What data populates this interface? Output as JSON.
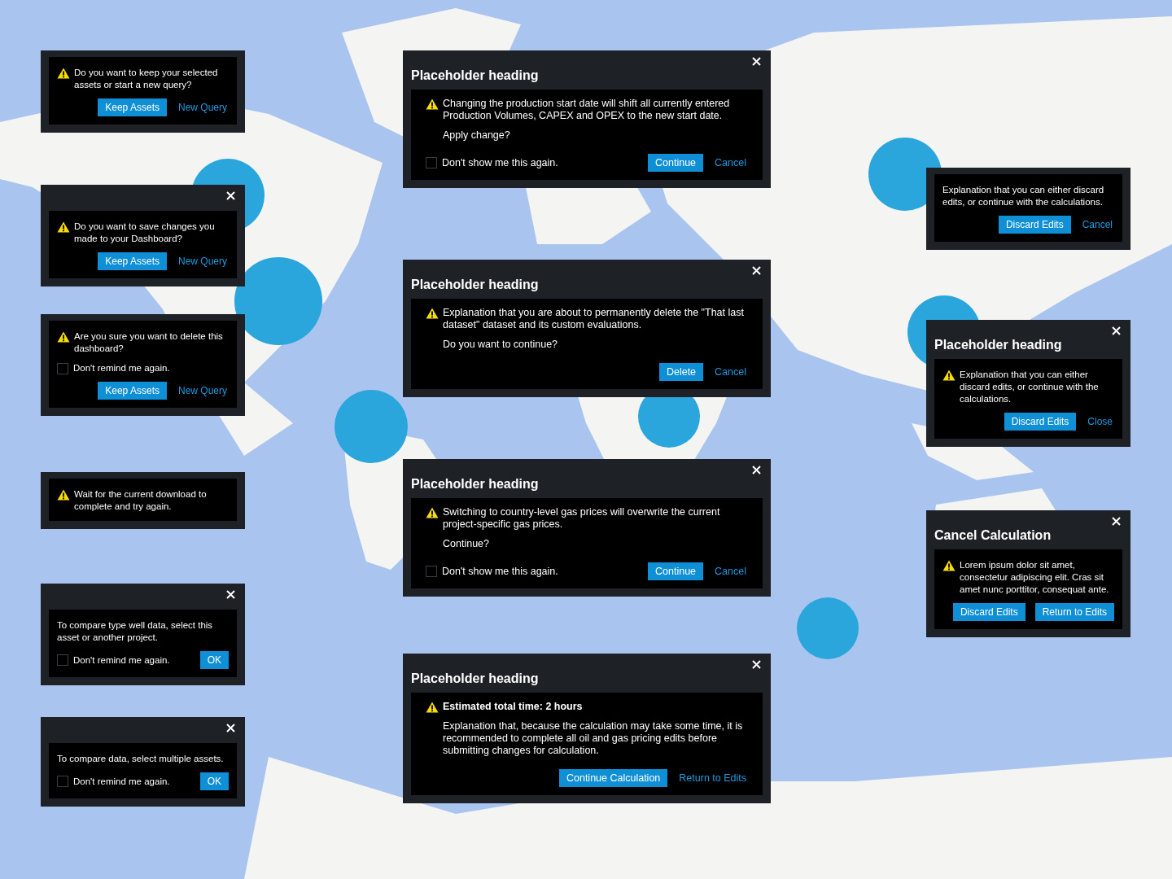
{
  "dialogs": [
    {
      "closable": false,
      "warning": true,
      "message": "Do you want to keep your selected assets or start a new query?",
      "buttons": [
        {
          "label": "Keep Assets",
          "kind": "primary"
        },
        {
          "label": "New Query",
          "kind": "link"
        }
      ]
    },
    {
      "closable": true,
      "warning": true,
      "message": "Do you want to save changes you made to your Dashboard?",
      "buttons": [
        {
          "label": "Keep Assets",
          "kind": "primary"
        },
        {
          "label": "New Query",
          "kind": "link"
        }
      ]
    },
    {
      "closable": false,
      "warning": true,
      "message": "Are you sure you want to delete this dashboard?",
      "checkbox": {
        "label": "Don't remind me again.",
        "checked": false,
        "kind": "row"
      },
      "buttons": [
        {
          "label": "Keep Assets",
          "kind": "primary"
        },
        {
          "label": "New Query",
          "kind": "link"
        }
      ]
    },
    {
      "closable": false,
      "warning": true,
      "message": "Wait for the current download to complete and try again."
    },
    {
      "closable": true,
      "warning": false,
      "message": "To compare type well data, select this asset or another project.",
      "checkbox": {
        "label": "Don't remind me again.",
        "checked": false,
        "kind": "footer"
      },
      "buttons": [
        {
          "label": "OK",
          "kind": "primary"
        }
      ]
    },
    {
      "closable": true,
      "warning": false,
      "message": "To compare data, select multiple assets.",
      "checkbox": {
        "label": "Don't remind me again.",
        "checked": false,
        "kind": "footer"
      },
      "buttons": [
        {
          "label": "OK",
          "kind": "primary"
        }
      ]
    },
    {
      "heading": "Placeholder heading",
      "closable": true,
      "warning": true,
      "message": "Changing the production start date will shift all currently entered Production Volumes, CAPEX and OPEX to the new start date.",
      "paragraphs": [
        "Apply change?"
      ],
      "checkbox": {
        "label": "Don't show me this again.",
        "checked": false,
        "kind": "footer"
      },
      "buttons": [
        {
          "label": "Continue",
          "kind": "primary"
        },
        {
          "label": "Cancel",
          "kind": "link"
        }
      ]
    },
    {
      "heading": "Placeholder heading",
      "closable": true,
      "warning": true,
      "message": "Explanation that you are about to permanently delete the \"That last dataset\" dataset and its custom evaluations.",
      "paragraphs": [
        "Do you want to continue?"
      ],
      "buttons": [
        {
          "label": "Delete",
          "kind": "primary"
        },
        {
          "label": "Cancel",
          "kind": "link"
        }
      ]
    },
    {
      "heading": "Placeholder heading",
      "closable": true,
      "warning": true,
      "message": "Switching to country-level gas prices will overwrite the current project-specific gas prices.",
      "paragraphs": [
        "Continue?"
      ],
      "checkbox": {
        "label": "Don't show me this again.",
        "checked": false,
        "kind": "footer"
      },
      "buttons": [
        {
          "label": "Continue",
          "kind": "primary"
        },
        {
          "label": "Cancel",
          "kind": "link"
        }
      ]
    },
    {
      "heading": "Placeholder heading",
      "closable": true,
      "warning": true,
      "message_bold": true,
      "message": "Estimated total time: 2 hours",
      "paragraphs": [
        "Explanation that, because the calculation may take some time, it is recommended to complete all oil and gas pricing edits before submitting changes for calculation."
      ],
      "buttons": [
        {
          "label": "Continue Calculation",
          "kind": "primary"
        },
        {
          "label": "Return to Edits",
          "kind": "link"
        }
      ]
    },
    {
      "closable": false,
      "warning": false,
      "message": "Explanation that you can either discard edits, or continue with the calculations.",
      "buttons": [
        {
          "label": "Discard Edits",
          "kind": "primary"
        },
        {
          "label": "Cancel",
          "kind": "link"
        }
      ]
    },
    {
      "heading": "Placeholder heading",
      "closable": true,
      "warning": true,
      "message": "Explanation that you can either discard edits, or continue with the calculations.",
      "buttons": [
        {
          "label": "Discard Edits",
          "kind": "primary"
        },
        {
          "label": "Close",
          "kind": "link"
        }
      ]
    },
    {
      "heading": "Cancel Calculation",
      "closable": true,
      "warning": true,
      "message": "Lorem ipsum dolor sit amet, consectetur adipiscing elit. Cras sit amet nunc porttitor, consequat ante.",
      "buttons": [
        {
          "label": "Discard Edits",
          "kind": "primary"
        },
        {
          "label": "Return to Edits",
          "kind": "primary"
        }
      ]
    }
  ]
}
